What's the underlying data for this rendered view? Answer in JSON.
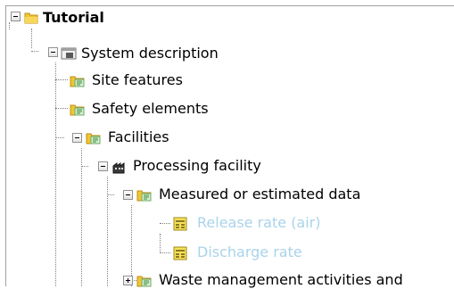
{
  "tree": {
    "root": {
      "label": "Tutorial",
      "icon": "folder-icon",
      "expanded": true
    },
    "system_description": {
      "label": "System description",
      "icon": "system-icon",
      "expanded": true
    },
    "site_features": {
      "label": "Site features",
      "icon": "category-folder-icon"
    },
    "safety_elements": {
      "label": "Safety elements",
      "icon": "category-folder-icon"
    },
    "facilities": {
      "label": "Facilities",
      "icon": "category-folder-icon",
      "expanded": true
    },
    "processing_facility": {
      "label": "Processing facility",
      "icon": "facility-icon",
      "expanded": true
    },
    "measured_data": {
      "label": "Measured or estimated data",
      "icon": "category-folder-icon",
      "expanded": true
    },
    "release_rate": {
      "label": "Release rate (air)",
      "icon": "data-table-icon",
      "disabled": true
    },
    "discharge_rate": {
      "label": "Discharge rate",
      "icon": "data-table-icon",
      "disabled": true
    },
    "waste_management": {
      "label": "Waste management activities and",
      "icon": "category-folder-icon",
      "expanded": false
    }
  },
  "colors": {
    "disabled_text": "#a9d3ea",
    "folder": "#f2c531",
    "folder_green": "#7cc47a"
  }
}
